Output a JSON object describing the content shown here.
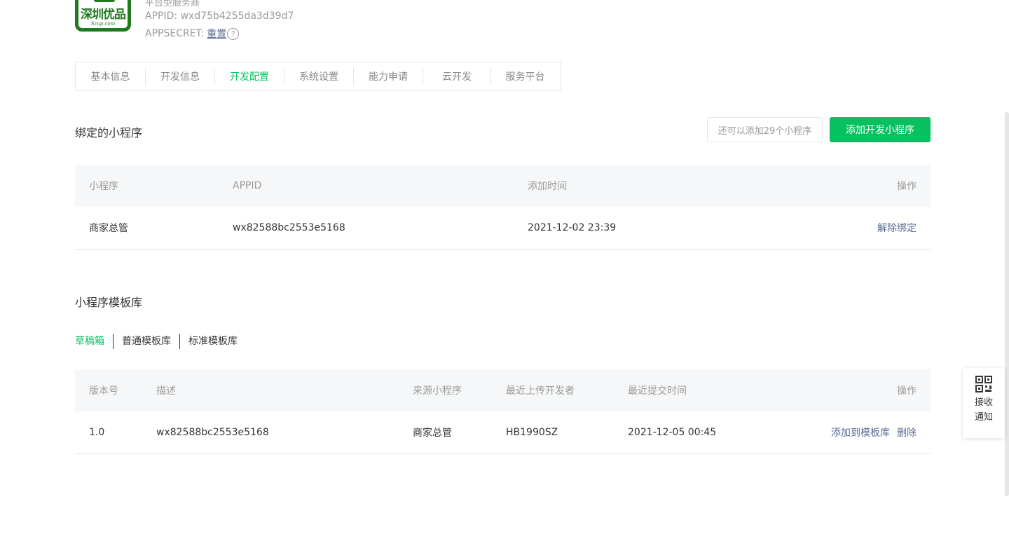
{
  "account": {
    "logo_text": "深圳优品",
    "logo_subtext": "Szup.com",
    "type_label": "平台型服务商",
    "appid_text": "APPID: wxd75b4255da3d39d7",
    "secret_label": "APPSECRET:",
    "reset_label": "重置",
    "help_symbol": "?"
  },
  "tabs": [
    {
      "label": "基本信息",
      "active": false
    },
    {
      "label": "开发信息",
      "active": false
    },
    {
      "label": "开发配置",
      "active": true
    },
    {
      "label": "系统设置",
      "active": false
    },
    {
      "label": "能力申请",
      "active": false
    },
    {
      "label": "云开发",
      "active": false
    },
    {
      "label": "服务平台",
      "active": false
    }
  ],
  "bound": {
    "title": "绑定的小程序",
    "remaining_text": "还可以添加29个小程序",
    "add_button": "添加开发小程序",
    "columns": [
      "小程序",
      "APPID",
      "添加时间",
      "操作"
    ],
    "rows": [
      {
        "name": "商家总管",
        "appid": "wx82588bc2553e5168",
        "time": "2021-12-02 23:39",
        "action": "解除绑定"
      }
    ]
  },
  "templates": {
    "title": "小程序模板库",
    "subtabs": [
      {
        "label": "草稿箱",
        "active": true
      },
      {
        "label": "普通模板库",
        "active": false
      },
      {
        "label": "标准模板库",
        "active": false
      }
    ],
    "columns": [
      "版本号",
      "描述",
      "来源小程序",
      "最近上传开发者",
      "最近提交时间",
      "操作"
    ],
    "rows": [
      {
        "version": "1.0",
        "desc": "wx82588bc2553e5168",
        "source": "商家总管",
        "developer": "HB1990SZ",
        "time": "2021-12-05 00:45",
        "action_add": "添加到模板库",
        "action_delete": "删除"
      }
    ]
  },
  "float_notice": {
    "icon": "qrcode-icon",
    "label": "接收通知"
  },
  "colors": {
    "accent": "#07c160",
    "link": "#576b95",
    "logo_green": "#1f7a1f"
  }
}
